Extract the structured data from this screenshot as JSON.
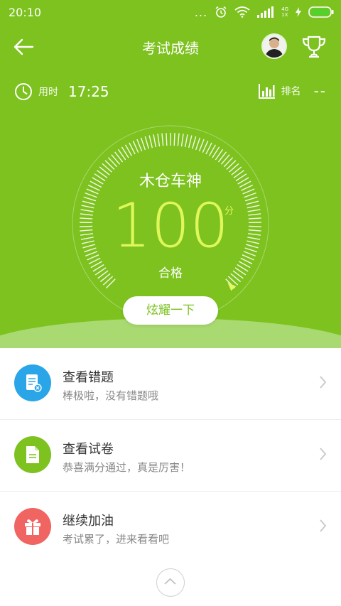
{
  "status_bar": {
    "time": "20:10",
    "dots": "...",
    "network_top": "4G",
    "network_bottom": "1X"
  },
  "header": {
    "title": "考试成绩",
    "back_icon": "arrow-left-icon",
    "avatar_icon": "user-avatar",
    "trophy_icon": "trophy-icon"
  },
  "stats": {
    "time_label": "用时",
    "time_value": "17:25",
    "rank_label": "排名",
    "rank_value": "--"
  },
  "result": {
    "title": "木仓车神",
    "score": "100",
    "unit": "分",
    "status": "合格",
    "share_label": "炫耀一下"
  },
  "menu": {
    "items": [
      {
        "icon": "wrong-questions-icon",
        "color": "#2aa6e8",
        "title": "查看错题",
        "subtitle": "棒极啦，没有错题哦"
      },
      {
        "icon": "paper-icon",
        "color": "#7dc21f",
        "title": "查看试卷",
        "subtitle": "恭喜满分通过，真是厉害！"
      },
      {
        "icon": "gift-icon",
        "color": "#f06461",
        "title": "继续加油",
        "subtitle": "考试累了，进来看看吧"
      }
    ]
  },
  "colors": {
    "hero_green": "#7dc21f",
    "score_yellow": "#dff75a"
  }
}
